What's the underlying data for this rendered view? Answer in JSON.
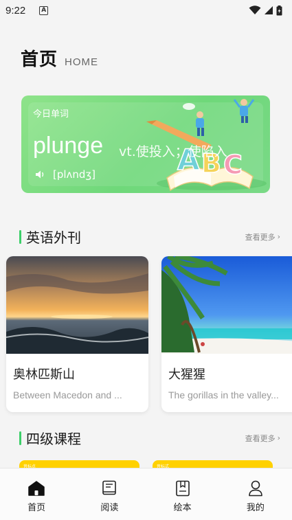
{
  "status": {
    "time": "9:22",
    "notification": "A"
  },
  "header": {
    "title": "首页",
    "subtitle": "HOME"
  },
  "word_card": {
    "label": "今日单词",
    "word": "plunge",
    "meaning": "vt.使投入；使陷入",
    "phonetic": "[plʌndʒ]",
    "icons": [
      "speaker-icon"
    ]
  },
  "section_magazine": {
    "title": "英语外刊",
    "more": "查看更多"
  },
  "articles": [
    {
      "title": "奥林匹斯山",
      "desc": "Between Macedon and ..."
    },
    {
      "title": "大猩猩",
      "desc": "The gorillas in the valley..."
    }
  ],
  "section_courses": {
    "title": "四级课程",
    "more": "查看更多"
  },
  "courses": [
    {
      "tag": "音标点"
    },
    {
      "tag": "音标式"
    }
  ],
  "tabs": [
    {
      "label": "首页",
      "icon": "home-icon",
      "active": true
    },
    {
      "label": "阅读",
      "icon": "book-icon",
      "active": false
    },
    {
      "label": "绘本",
      "icon": "picture-book-icon",
      "active": false
    },
    {
      "label": "我的",
      "icon": "user-icon",
      "active": false
    }
  ],
  "colors": {
    "accent": "#3dcf6a",
    "card_green": "#7ad987",
    "course_yellow": "#ffd100"
  }
}
